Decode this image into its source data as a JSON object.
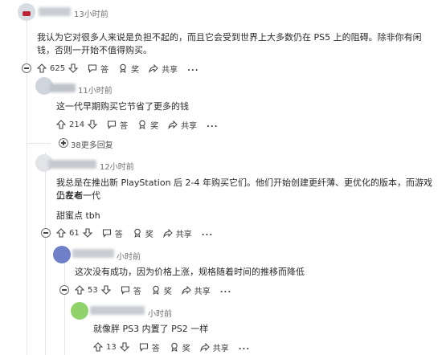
{
  "comments": [
    {
      "time": "13小时前",
      "text": "我认为它对很多人来说是负担不起的，而且它会受到世界上大多数仍在 PS5 上的阻碍。除非你有闲钱，否则一开始不值得购买。",
      "votes": "625",
      "reply": "答",
      "award": "奖",
      "share": "共享"
    },
    {
      "time": "11小时前",
      "text": "这一代早期购买它节省了更多的钱",
      "votes": "214",
      "reply": "答",
      "award": "奖",
      "share": "共享",
      "more_replies": "38更多回复"
    },
    {
      "time": "12小时前",
      "text_line1": "我总是在推出新 PlayStation 后 2-4 年购买它们。他们开始创建更纤薄、更优化的版本，而游戏仍在老一代",
      "text_line2": "上发布",
      "text_extra": "甜蜜点 tbh",
      "votes": "61",
      "reply": "答",
      "award": "奖",
      "share": "共享"
    },
    {
      "time": "小时前",
      "text": "这次没有成功，因为价格上涨，规格随着时间的推移而降低",
      "votes": "53",
      "reply": "答",
      "award": "奖",
      "share": "共享"
    },
    {
      "time": "小时前",
      "text": "就像胖 PS3 内置了 PS2 一样",
      "votes": "13",
      "reply": "答",
      "award": "奖",
      "share": "共享"
    }
  ],
  "more_menu": "...",
  "icons": [
    "upvote-icon",
    "downvote-icon",
    "reply-icon",
    "award-icon",
    "share-icon",
    "collapse-icon",
    "expand-icon"
  ]
}
